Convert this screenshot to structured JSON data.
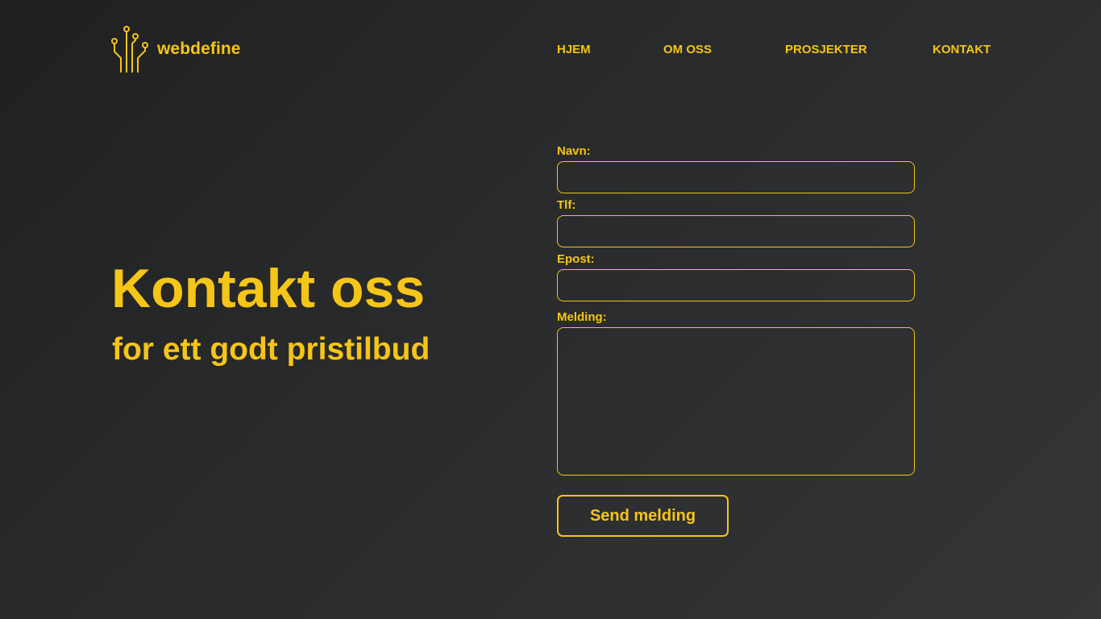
{
  "colors": {
    "accent": "#f5c518",
    "background_dark": "#1f2020",
    "background_light": "#333537"
  },
  "header": {
    "logo_icon": "circuit-icon",
    "logo_text": "webdefine",
    "nav": [
      {
        "label": "HJEM"
      },
      {
        "label": "OM OSS"
      },
      {
        "label": "PROSJEKTER"
      },
      {
        "label": "KONTAKT"
      }
    ]
  },
  "hero": {
    "title": "Kontakt oss",
    "subtitle": "for ett godt pristilbud"
  },
  "form": {
    "name_label": "Navn:",
    "phone_label": "Tlf:",
    "email_label": "Epost:",
    "message_label": "Melding:",
    "name_value": "",
    "phone_value": "",
    "email_value": "",
    "message_value": "",
    "submit_label": "Send melding"
  }
}
